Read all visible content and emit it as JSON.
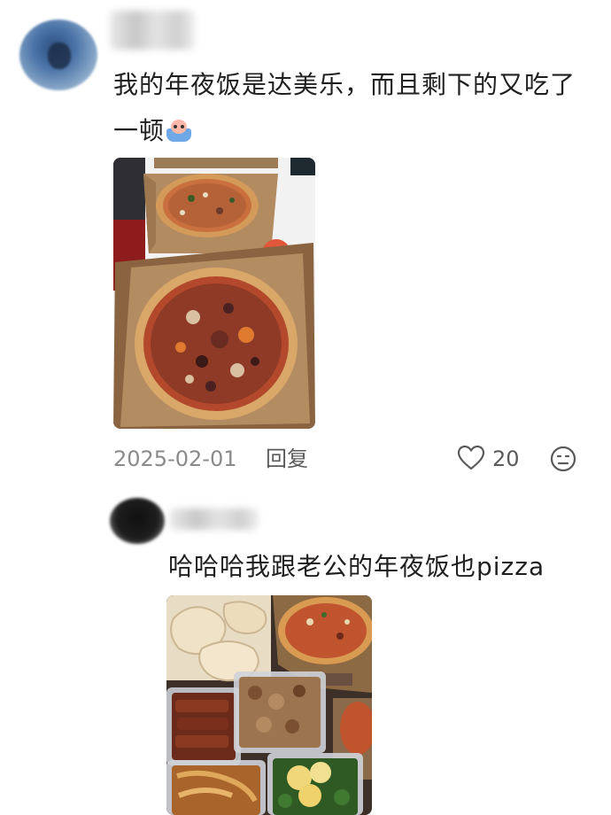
{
  "comments": [
    {
      "text": "我的年夜饭是达美乐，而且剩下的又吃了一顿",
      "emoji": "crying-emoji",
      "date": "2025-02-01",
      "reply_label": "回复",
      "likes": "20",
      "image": "pizza-boxes-photo"
    },
    {
      "text": "哈哈哈我跟老公的年夜饭也pizza",
      "image": "dinner-spread-photo"
    }
  ],
  "icons": {
    "like": "heart-outline-icon",
    "react": "smiley-face-icon"
  },
  "colors": {
    "text": "#1f1f1f",
    "meta": "#8a8a8a",
    "reply": "#5a5a5a",
    "background": "#ffffff"
  }
}
